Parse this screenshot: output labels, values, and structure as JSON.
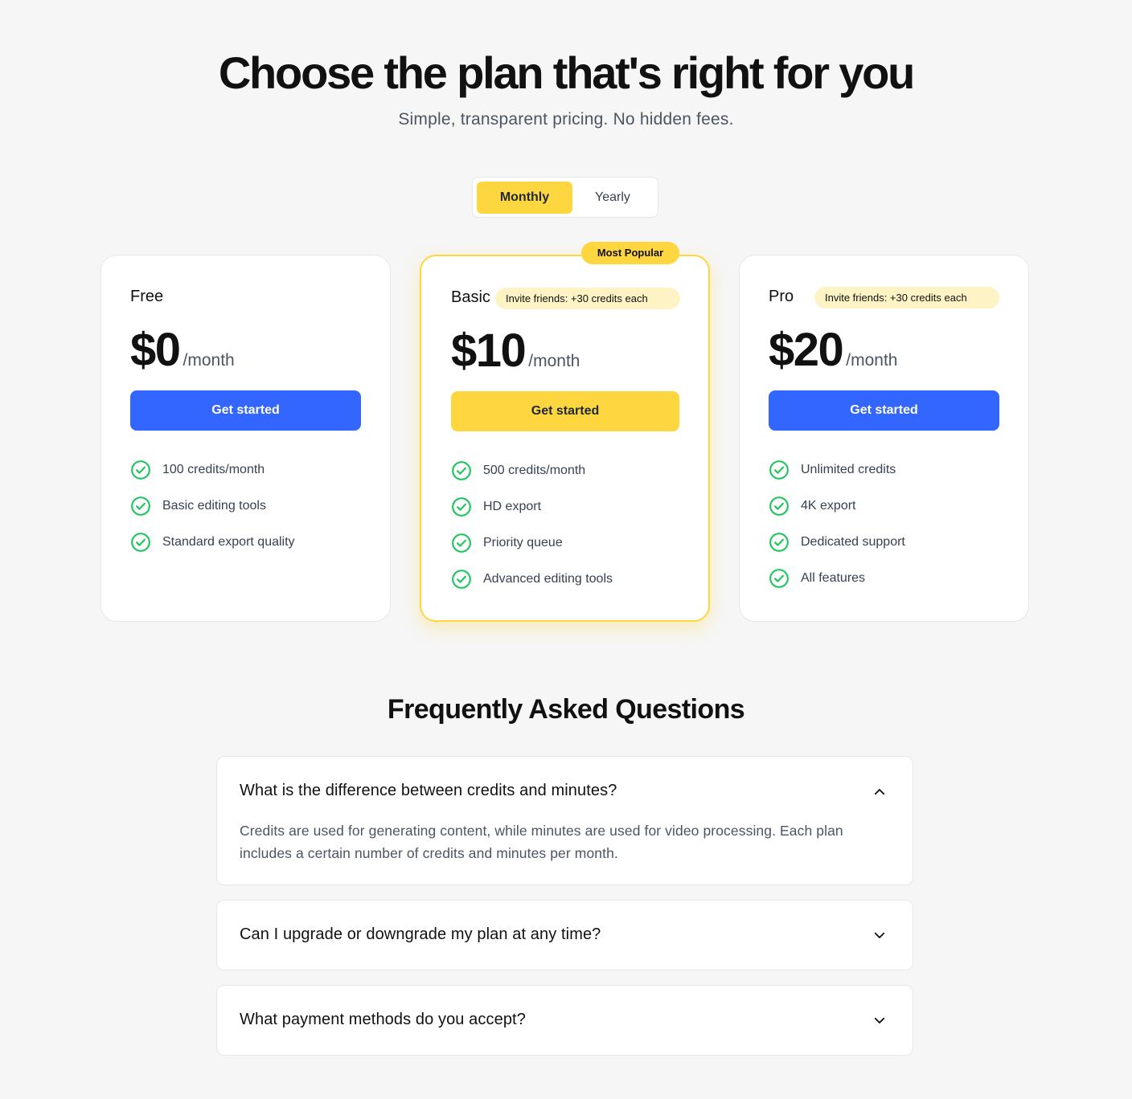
{
  "header": {
    "title": "Choose the plan that's right for you",
    "subtitle": "Simple, transparent pricing. No hidden fees."
  },
  "billing_toggle": {
    "options": [
      "Monthly",
      "Yearly"
    ],
    "selected": "Monthly"
  },
  "plans": [
    {
      "name": "Free",
      "price": "$0",
      "period": "/month",
      "cta": "Get started",
      "features": [
        "100 credits/month",
        "Basic editing tools",
        "Standard export quality"
      ]
    },
    {
      "name": "Basic",
      "badge": "Most Popular",
      "invite": "Invite friends: +30 credits each",
      "price": "$10",
      "period": "/month",
      "cta": "Get started",
      "features": [
        "500 credits/month",
        "HD export",
        "Priority queue",
        "Advanced editing tools"
      ]
    },
    {
      "name": "Pro",
      "invite": "Invite friends: +30 credits each",
      "price": "$20",
      "period": "/month",
      "cta": "Get started",
      "features": [
        "Unlimited credits",
        "4K export",
        "Dedicated support",
        "All features"
      ]
    }
  ],
  "faq": {
    "title": "Frequently Asked Questions",
    "items": [
      {
        "question": "What is the difference between credits and minutes?",
        "answer": "Credits are used for generating content, while minutes are used for video processing. Each plan includes a certain number of credits and minutes per month.",
        "expanded": true
      },
      {
        "question": "Can I upgrade or downgrade my plan at any time?",
        "expanded": false
      },
      {
        "question": "What payment methods do you accept?",
        "expanded": false
      }
    ]
  },
  "colors": {
    "accent_yellow": "#fdd640",
    "primary_blue": "#3366ff",
    "check_green": "#22c55e",
    "background": "#f6f6f6"
  },
  "icons": {
    "feature": "check-circle-icon",
    "faq_expanded": "chevron-up-icon",
    "faq_collapsed": "chevron-down-icon"
  }
}
